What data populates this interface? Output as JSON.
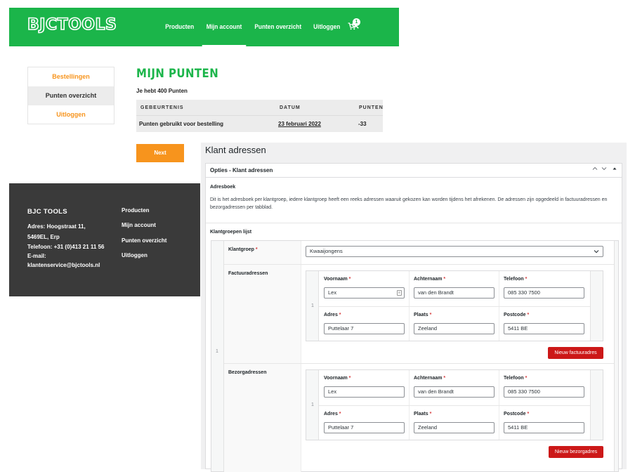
{
  "store": {
    "logo": "BJCTOOLS",
    "nav": [
      "Producten",
      "Mijn account",
      "Punten overzicht",
      "Uitloggen"
    ],
    "active_nav": "Mijn account",
    "search_icon": "search-icon",
    "cart_icon": "cart-icon",
    "cart_count": "1",
    "brand_color": "#1bb54a",
    "accent_color": "#f7941d"
  },
  "account_menu": {
    "items": [
      "Bestellingen",
      "Punten overzicht",
      "Uitloggen"
    ],
    "active": "Punten overzicht"
  },
  "points": {
    "title": "MIJN PUNTEN",
    "balance_text": "Je hebt 400 Punten",
    "columns": [
      "GEBEURTENIS",
      "DATUM",
      "PUNTEN"
    ],
    "rows": [
      {
        "event": "Punten gebruikt voor bestelling",
        "date": "23 februari 2022",
        "points": "-33"
      }
    ],
    "next_label": "Next"
  },
  "footer": {
    "title": "BJC TOOLS",
    "address_line1": "Adres: Hoogstraat 11,",
    "address_line2": "5469EL, Erp",
    "phone": "Telefoon: +31 (0)413 21 11 56",
    "email_label": "E-mail:",
    "email": "klantenservice@bjctools.nl",
    "links": [
      "Producten",
      "Mijn account",
      "Punten overzicht",
      "Uitloggen"
    ]
  },
  "admin": {
    "page_title": "Klant adressen",
    "box_title": "Opties - Klant adressen",
    "section_title": "Adresboek",
    "description": "Dit is het adresboek per klantgroep, iedere klantgroep heeft een reeks adressen waaruit gekozen kan worden tijdens het afrekenen. De adressen zijn opgedeeld in factuuradressen en bezorgadressen per tabblad.",
    "list_label": "Klantgroepen lijst",
    "row_index": "1",
    "klantgroep_label": "Klantgroep",
    "klantgroep_value": "Kwaaijongens",
    "required_mark": "*",
    "factuur": {
      "label": "Factuuradressen",
      "index": "1",
      "voornaam_label": "Voornaam",
      "achternaam_label": "Achternaam",
      "telefoon_label": "Telefoon",
      "adres_label": "Adres",
      "plaats_label": "Plaats",
      "postcode_label": "Postcode",
      "voornaam": "Lex",
      "achternaam": "van den Brandt",
      "telefoon": "085 330 7500",
      "adres": "Puttelaar 7",
      "plaats": "Zeeland",
      "postcode": "5411 BE",
      "button": "Nieuw factuuradres"
    },
    "bezorg": {
      "label": "Bezorgadressen",
      "index": "1",
      "voornaam_label": "Voornaam",
      "achternaam_label": "Achternaam",
      "telefoon_label": "Telefoon",
      "adres_label": "Adres",
      "plaats_label": "Plaats",
      "postcode_label": "Postcode",
      "voornaam": "Lex",
      "achternaam": "van den Brandt",
      "telefoon": "085 330 7500",
      "adres": "Puttelaar 7",
      "plaats": "Zeeland",
      "postcode": "5411 BE",
      "button": "Nieuw bezorgadres"
    },
    "danger_color": "#cc1818"
  }
}
